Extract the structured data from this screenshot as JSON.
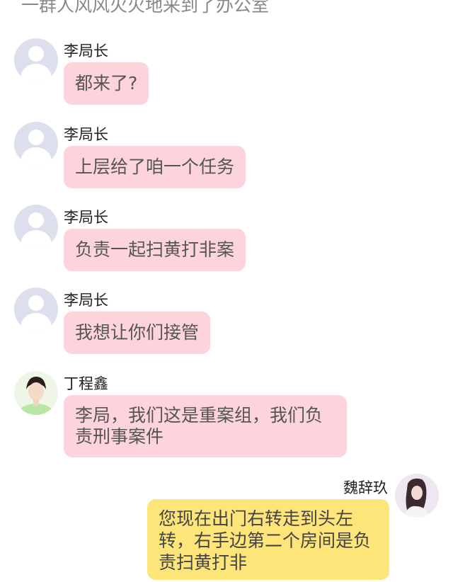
{
  "narration": "一群人风风火火地来到了办公室",
  "messages": [
    {
      "sender": "李局长",
      "text": "都来了?",
      "side": "left",
      "avatar": "default-avatar"
    },
    {
      "sender": "李局长",
      "text": "上层给了咱一个任务",
      "side": "left",
      "avatar": "default-avatar"
    },
    {
      "sender": "李局长",
      "text": "负责一起扫黄打非案",
      "side": "left",
      "avatar": "default-avatar"
    },
    {
      "sender": "李局长",
      "text": "我想让你们接管",
      "side": "left",
      "avatar": "default-avatar"
    },
    {
      "sender": "丁程鑫",
      "text": "李局，我们这是重案组，我们负责刑事案件",
      "side": "left",
      "avatar": "photo-avatar"
    },
    {
      "sender": "魏辞玖",
      "text": "您现在出门右转走到头左转，右手边第二个房间是负责扫黄打非",
      "side": "right",
      "avatar": "photo-avatar"
    }
  ],
  "colors": {
    "left_bubble": "#fdd4dc",
    "right_bubble": "#fde57a",
    "default_avatar": "#dde0ec"
  }
}
